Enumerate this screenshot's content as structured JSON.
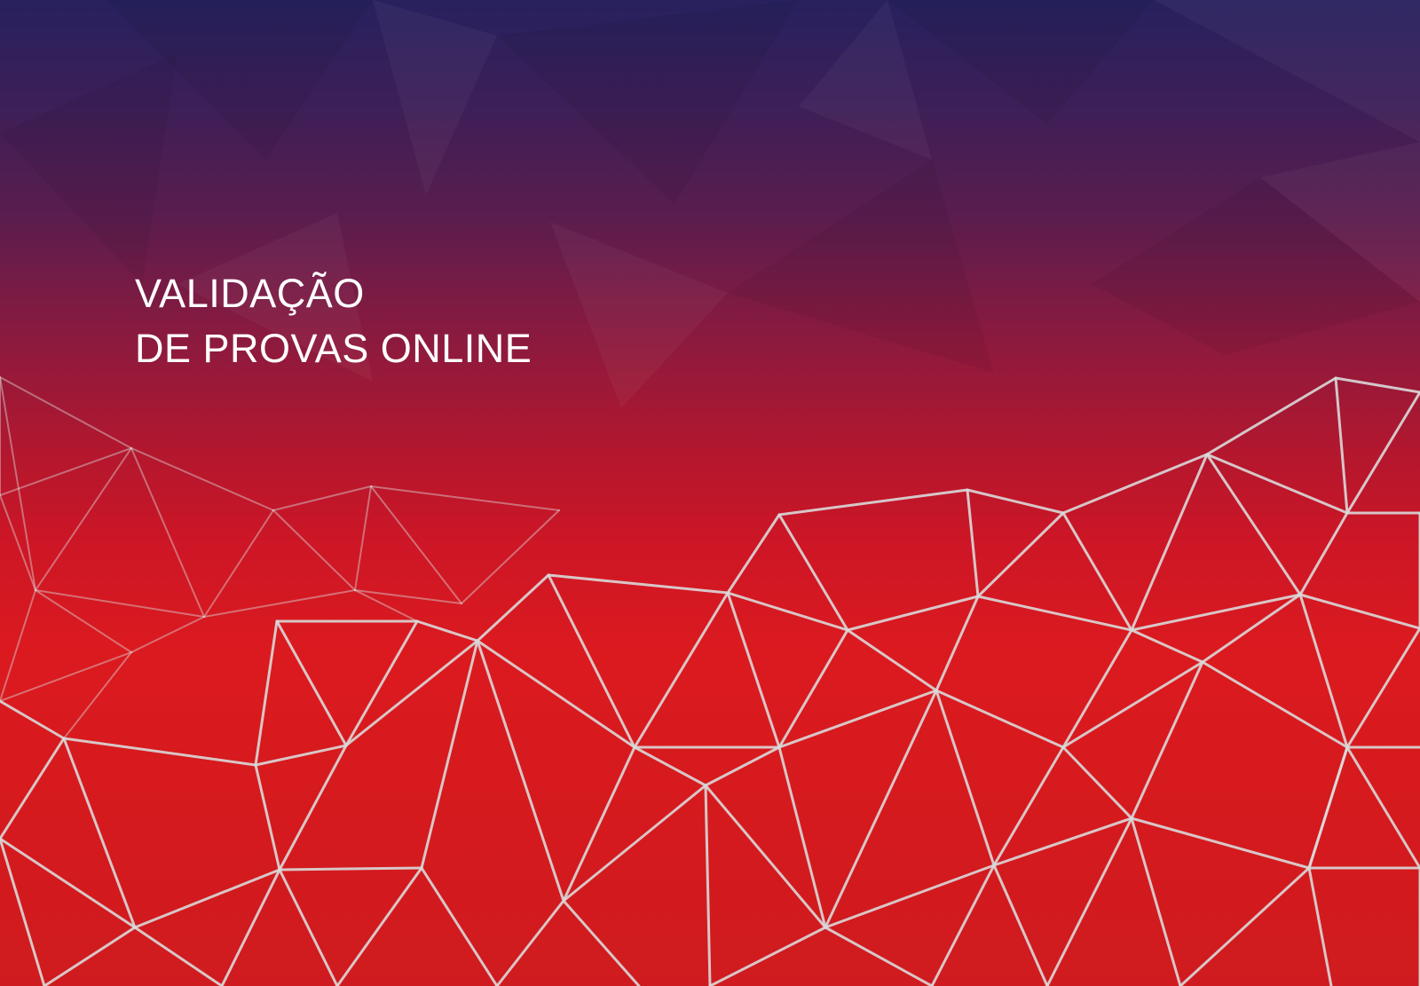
{
  "cover": {
    "headline": {
      "line1": "VALIDAÇÃO",
      "line2": "DE PROVAS ONLINE"
    }
  },
  "colors": {
    "gradient_top": "#27215e",
    "gradient_mid": "#8a1a3f",
    "gradient_bottom": "#d51a1e",
    "mesh_line": "#d9d9d9",
    "text": "#ffffff"
  }
}
